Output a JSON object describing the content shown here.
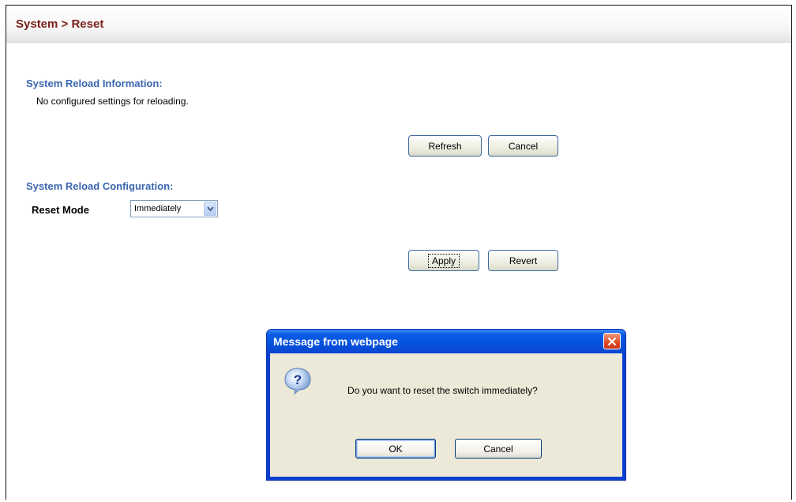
{
  "header": {
    "breadcrumb": "System > Reset"
  },
  "reload_info": {
    "title": "System Reload Information:",
    "message": "No configured settings for reloading.",
    "refresh_label": "Refresh",
    "cancel_label": "Cancel"
  },
  "reload_config": {
    "title": "System Reload Configuration:",
    "reset_mode_label": "Reset Mode",
    "reset_mode_value": "Immediately",
    "apply_label": "Apply",
    "revert_label": "Revert"
  },
  "dialog": {
    "title": "Message from webpage",
    "message": "Do you want to reset the switch immediately?",
    "ok_label": "OK",
    "cancel_label": "Cancel"
  },
  "colors": {
    "header_text": "#7a1f1a",
    "section_title": "#3a66b0",
    "dialog_title_bar": "#0550dc",
    "dialog_body": "#ece9d8"
  }
}
